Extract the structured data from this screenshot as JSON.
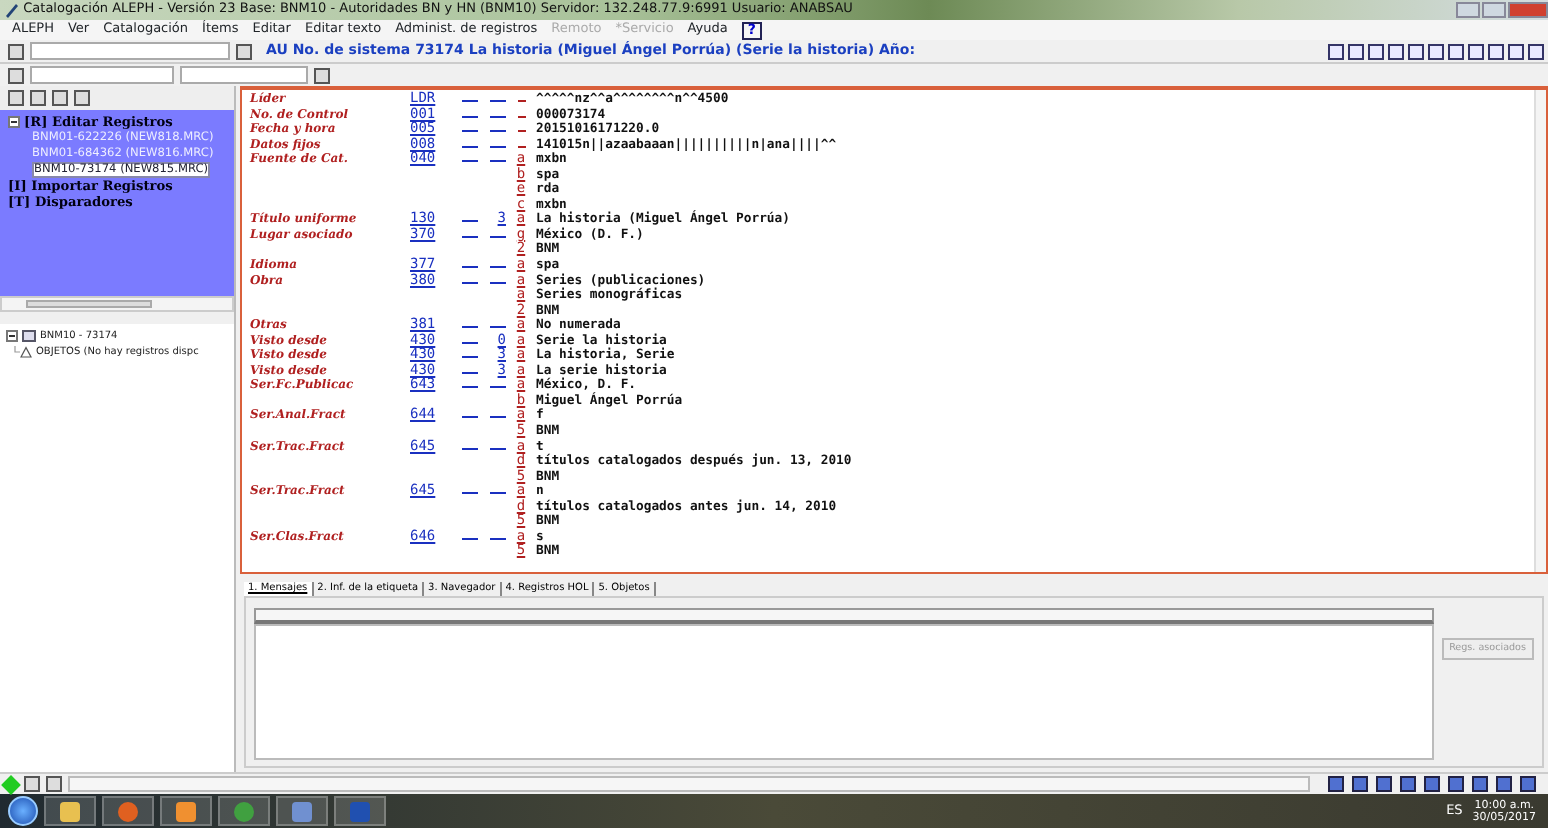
{
  "window": {
    "title": "Catalogación ALEPH - Versión 23  Base:  BNM10 - Autoridades BN y HN (BNM10)  Servidor: 132.248.77.9:6991   Usuario: ANABSAU"
  },
  "menu": [
    {
      "label": "ALEPH",
      "disabled": false
    },
    {
      "label": "Ver",
      "disabled": false
    },
    {
      "label": "Catalogación",
      "disabled": false
    },
    {
      "label": "Ítems",
      "disabled": false
    },
    {
      "label": "Editar",
      "disabled": false
    },
    {
      "label": "Editar texto",
      "disabled": false
    },
    {
      "label": "Administ. de registros",
      "disabled": false
    },
    {
      "label": "Remoto",
      "disabled": true
    },
    {
      "label": "*Servicio",
      "disabled": true
    },
    {
      "label": "Ayuda",
      "disabled": false
    },
    {
      "label": "?",
      "disabled": false
    }
  ],
  "toolbar": {
    "record_title": "AU No. de sistema 73174 La historia (Miguel Ángel Porrúa) (Serie la historia) Año:"
  },
  "tree": [
    {
      "label": "[R] Editar Registros",
      "expanded": true,
      "selected": false,
      "children": [
        {
          "label": "BNM01-622226 (NEW818.MRC)",
          "selected": false
        },
        {
          "label": "BNM01-684362 (NEW816.MRC)",
          "selected": false
        },
        {
          "label": "BNM10-73174 (NEW815.MRC)",
          "selected": true
        }
      ]
    },
    {
      "label": "[I] Importar Registros",
      "selected": false
    },
    {
      "label": "[T] Disparadores",
      "selected": false
    }
  ],
  "record_tree": {
    "label": "BNM10 - 73174",
    "expanded": true,
    "children": [
      {
        "label": "OBJETOS (No hay registros dispc"
      }
    ]
  },
  "record": {
    "fields": [
      {
        "label": "Líder",
        "tag": "LDR",
        "subfields": [
          {
            "value": "^^^^^nz^^a^^^^^^^^n^^4500"
          }
        ]
      },
      {
        "label": "No. de Control",
        "tag": "001",
        "subfields": [
          {
            "value": "000073174"
          }
        ]
      },
      {
        "label": "Fecha y hora",
        "tag": "005",
        "subfields": [
          {
            "value": "20151016171220.0"
          }
        ]
      },
      {
        "label": "Datos fijos",
        "tag": "008",
        "subfields": [
          {
            "value": "141015n||azaabaaan||||||||||n|ana||||^^"
          }
        ]
      },
      {
        "label": "Fuente de Cat.",
        "tag": "040",
        "subfields": [
          {
            "code": "a",
            "value": "mxbn"
          },
          {
            "code": "b",
            "value": "spa"
          },
          {
            "code": "e",
            "value": "rda"
          },
          {
            "code": "c",
            "value": "mxbn"
          }
        ]
      },
      {
        "label": "Título uniforme",
        "tag": "130",
        "ind2": "3",
        "subfields": [
          {
            "code": "a",
            "value": "La historia (Miguel Ángel Porrúa)"
          }
        ]
      },
      {
        "label": "Lugar asociado",
        "tag": "370",
        "subfields": [
          {
            "code": "g",
            "value": "México (D. F.)"
          },
          {
            "code": "2",
            "value": "BNM"
          }
        ]
      },
      {
        "label": "Idioma",
        "tag": "377",
        "subfields": [
          {
            "code": "a",
            "value": "spa"
          }
        ]
      },
      {
        "label": "Obra",
        "tag": "380",
        "subfields": [
          {
            "code": "a",
            "value": "Series (publicaciones)"
          },
          {
            "code": "a",
            "value": "Series monográficas"
          },
          {
            "code": "2",
            "value": "BNM"
          }
        ]
      },
      {
        "label": "Otras",
        "tag": "381",
        "subfields": [
          {
            "code": "a",
            "value": "No numerada"
          }
        ]
      },
      {
        "label": "Visto desde",
        "tag": "430",
        "ind2": "0",
        "subfields": [
          {
            "code": "a",
            "value": "Serie la historia"
          }
        ]
      },
      {
        "label": "Visto desde",
        "tag": "430",
        "ind2": "3",
        "subfields": [
          {
            "code": "a",
            "value": "La historia, Serie"
          }
        ]
      },
      {
        "label": "Visto desde",
        "tag": "430",
        "ind2": "3",
        "subfields": [
          {
            "code": "a",
            "value": "La serie historia"
          }
        ]
      },
      {
        "label": "Ser.Fc.Publicac",
        "tag": "643",
        "subfields": [
          {
            "code": "a",
            "value": "México, D. F."
          },
          {
            "code": "b",
            "value": "Miguel Ángel Porrúa"
          }
        ]
      },
      {
        "label": "Ser.Anal.Fract",
        "tag": "644",
        "subfields": [
          {
            "code": "a",
            "value": "f"
          },
          {
            "code": "5",
            "value": "BNM"
          }
        ]
      },
      {
        "label": "Ser.Trac.Fract",
        "tag": "645",
        "subfields": [
          {
            "code": "a",
            "value": "t"
          },
          {
            "code": "d",
            "value": "títulos catalogados después jun. 13, 2010"
          },
          {
            "code": "5",
            "value": "BNM"
          }
        ]
      },
      {
        "label": "Ser.Trac.Fract",
        "tag": "645",
        "subfields": [
          {
            "code": "a",
            "value": "n"
          },
          {
            "code": "d",
            "value": "títulos catalogados antes jun. 14, 2010"
          },
          {
            "code": "5",
            "value": "BNM"
          }
        ]
      },
      {
        "label": "Ser.Clas.Fract",
        "tag": "646",
        "subfields": [
          {
            "code": "a",
            "value": "s"
          },
          {
            "code": "5",
            "value": "BNM"
          }
        ]
      }
    ]
  },
  "bottom_tabs": [
    {
      "label": "1. Mensajes",
      "selected": true
    },
    {
      "label": "2. Inf. de la etiqueta",
      "selected": false
    },
    {
      "label": "3. Navegador",
      "selected": false
    },
    {
      "label": "4. Registros HOL",
      "selected": false
    },
    {
      "label": "5. Objetos",
      "selected": false
    }
  ],
  "associated_button": {
    "label": "Regs. asociados",
    "disabled": true
  },
  "taskbar": {
    "language": "ES",
    "time": "10:00 a.m.",
    "date": "30/05/2017"
  }
}
